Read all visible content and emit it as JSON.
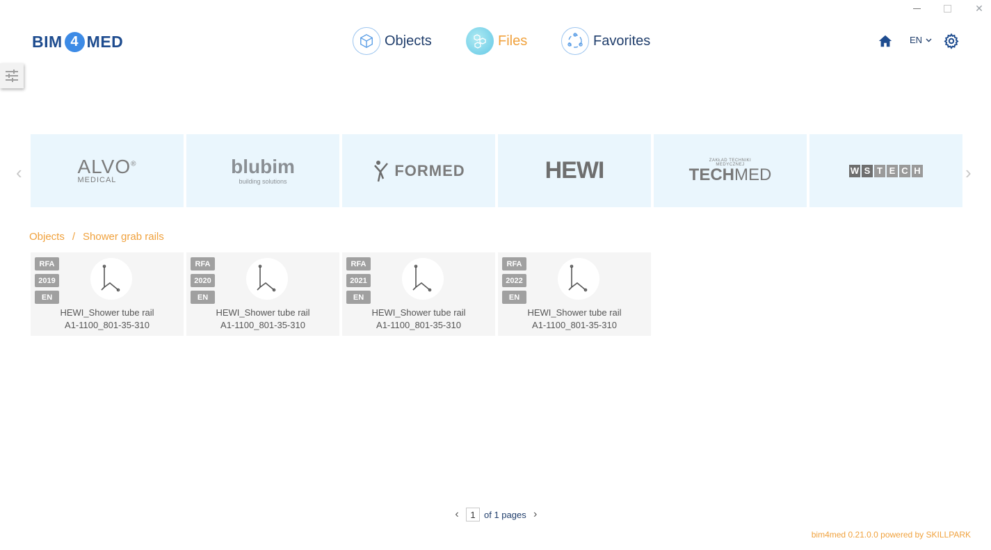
{
  "window": {
    "min_icon": "minimize-icon",
    "max_icon": "maximize-icon",
    "close_icon": "close-icon",
    "close_glyph": "✕"
  },
  "logo": {
    "left": "BIM",
    "middle": "4",
    "right": "MED"
  },
  "nav": {
    "objects": {
      "label": "Objects",
      "icon": "cube-icon"
    },
    "files": {
      "label": "Files",
      "icon": "hexagons-icon"
    },
    "favorites": {
      "label": "Favorites",
      "icon": "network-icon"
    }
  },
  "header": {
    "lang": "EN",
    "home_icon": "home-icon",
    "settings_icon": "gear-icon"
  },
  "carousel": {
    "brands": [
      {
        "name": "ALVO",
        "sub": "MEDICAL"
      },
      {
        "name": "blubim",
        "sub": "building solutions"
      },
      {
        "name": "FORMED"
      },
      {
        "name": "HEWI"
      },
      {
        "pre1": "ZAKŁAD TECHNIKI",
        "pre2": "MEDYCZNEJ",
        "name_a": "TECH",
        "name_b": "MED"
      },
      {
        "letters": [
          "W",
          "S",
          "T",
          "E",
          "C",
          "H"
        ]
      }
    ],
    "prev": "‹",
    "next": "›"
  },
  "breadcrumb": {
    "root": "Objects",
    "sep": "/",
    "current": "Shower grab rails"
  },
  "cards": [
    {
      "format": "RFA",
      "year": "2019",
      "lang": "EN",
      "title1": "HEWI_Shower tube rail",
      "title2": "A1-1100_801-35-310"
    },
    {
      "format": "RFA",
      "year": "2020",
      "lang": "EN",
      "title1": "HEWI_Shower tube rail",
      "title2": "A1-1100_801-35-310"
    },
    {
      "format": "RFA",
      "year": "2021",
      "lang": "EN",
      "title1": "HEWI_Shower tube rail",
      "title2": "A1-1100_801-35-310"
    },
    {
      "format": "RFA",
      "year": "2022",
      "lang": "EN",
      "title1": "HEWI_Shower tube rail",
      "title2": "A1-1100_801-35-310"
    }
  ],
  "pager": {
    "prev": "‹",
    "page": "1",
    "of_text": "of 1 pages",
    "next": "›"
  },
  "footer": {
    "text": "bim4med 0.21.0.0 powered by SKILLPARK"
  },
  "colors": {
    "accent": "#f0a13c",
    "primary": "#1f3d6b",
    "brand_bg": "#eaf6fd"
  }
}
